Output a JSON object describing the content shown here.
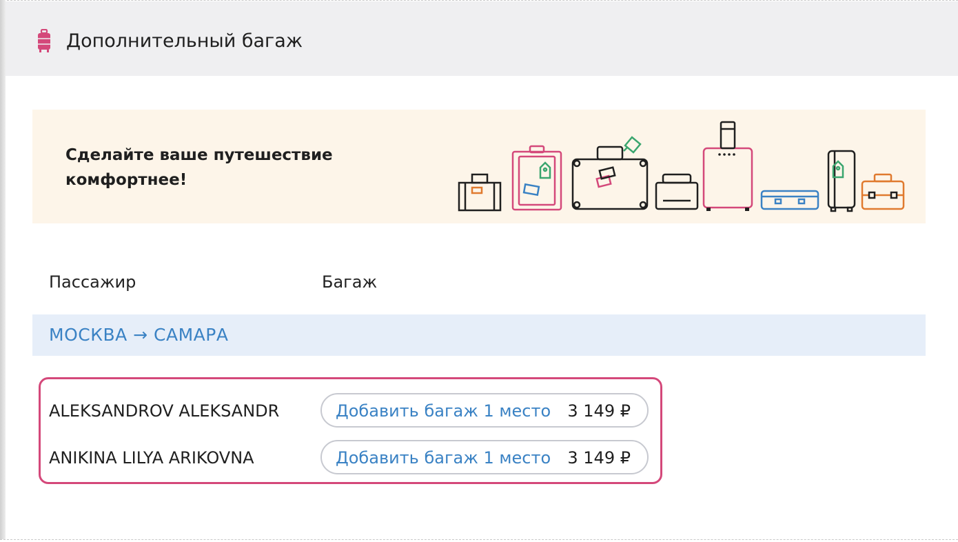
{
  "section": {
    "title": "Дополнительный багаж",
    "icon": "suitcase-icon",
    "accent_color": "#d4487a"
  },
  "banner": {
    "promo_text": "Сделайте ваше путешествие комфортнее!",
    "background_color": "#fdf5e9",
    "illustration": "luggage-illustration"
  },
  "table": {
    "columns": [
      "Пассажир",
      "Багаж"
    ]
  },
  "route": {
    "label": "МОСКВА → САМАРА",
    "color": "#3a82c4"
  },
  "passengers": [
    {
      "name": "ALEKSANDROV ALEKSANDR",
      "button_label": "Добавить багаж 1 место",
      "price": "3 149 ₽"
    },
    {
      "name": "ANIKINA LILYA ARIKOVNA",
      "button_label": "Добавить багаж 1 место",
      "price": "3 149 ₽"
    }
  ]
}
